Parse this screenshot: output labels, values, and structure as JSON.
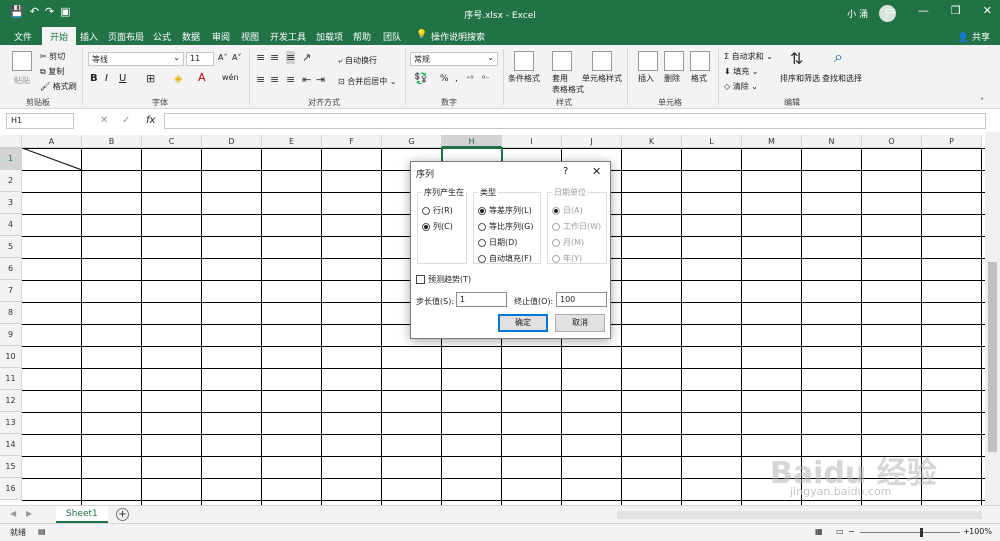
{
  "window": {
    "title": "序号.xlsx  -  Excel",
    "user": "小 涌",
    "minimize": "—",
    "restore": "❐",
    "close": "✕"
  },
  "qat": {
    "save_icon": "save-icon",
    "undo": "↶",
    "redo": "↷",
    "camera": "camera-icon"
  },
  "tabs": [
    "文件",
    "开始",
    "插入",
    "页面布局",
    "公式",
    "数据",
    "审阅",
    "视图",
    "开发工具",
    "加载项",
    "帮助",
    "团队",
    "操作说明搜索"
  ],
  "active_tab": "开始",
  "share_label": "共享",
  "ribbon": {
    "clipboard": {
      "paste": "粘贴",
      "cut": "剪切",
      "copy": "复制",
      "format_painter": "格式刷",
      "label": "剪贴板"
    },
    "font": {
      "family": "等线",
      "size": "11",
      "grow": "A˄",
      "shrink": "A˅",
      "bold": "B",
      "italic": "I",
      "underline": "U",
      "label": "字体",
      "wen": "wén"
    },
    "alignment": {
      "wrap": "自动换行",
      "merge": "合并后居中",
      "label": "对齐方式"
    },
    "number": {
      "format": "常规",
      "percent": "%",
      "comma": ",",
      "label": "数字"
    },
    "styles": {
      "conditional": "条件格式",
      "table": "套用\n表格格式",
      "cell": "单元格样式",
      "label": "样式"
    },
    "cells": {
      "insert": "插入",
      "delete": "删除",
      "format": "格式",
      "label": "单元格"
    },
    "editing": {
      "autosum": "自动求和",
      "fill": "填充",
      "clear": "清除",
      "sort": "排序和筛选",
      "find": "查找和选择",
      "label": "编辑"
    }
  },
  "formula_bar": {
    "name_box": "H1",
    "fx": "fx",
    "cancel": "✕",
    "enter": "✓",
    "value": ""
  },
  "columns": [
    "A",
    "B",
    "C",
    "D",
    "E",
    "F",
    "G",
    "H",
    "I",
    "J",
    "K",
    "L",
    "M",
    "N",
    "O",
    "P"
  ],
  "rows": [
    "1",
    "2",
    "3",
    "4",
    "5",
    "6",
    "7",
    "8",
    "9",
    "10",
    "11",
    "12",
    "13",
    "14",
    "15",
    "16"
  ],
  "selected_cell": "H1",
  "dialog": {
    "title": "序列",
    "help": "?",
    "close": "✕",
    "series_in": {
      "legend": "序列产生在",
      "options": [
        "行(R)",
        "列(C)"
      ],
      "selected": 1
    },
    "type": {
      "legend": "类型",
      "options": [
        "等差序列(L)",
        "等比序列(G)",
        "日期(D)",
        "自动填充(F)"
      ],
      "selected": 0
    },
    "date_unit": {
      "legend": "日期单位",
      "options": [
        "日(A)",
        "工作日(W)",
        "月(M)",
        "年(Y)"
      ],
      "selected": 0
    },
    "trend": "预测趋势(T)",
    "step_label": "步长值(S):",
    "step_value": "1",
    "stop_label": "终止值(O):",
    "stop_value": "100",
    "ok": "确定",
    "cancel": "取消"
  },
  "sheet": {
    "tab": "Sheet1",
    "add": "+"
  },
  "status": {
    "ready": "就绪",
    "zoom": "100%"
  },
  "watermark": {
    "logo": "Baidu 经验",
    "url": "jingyan.baidu.com"
  }
}
